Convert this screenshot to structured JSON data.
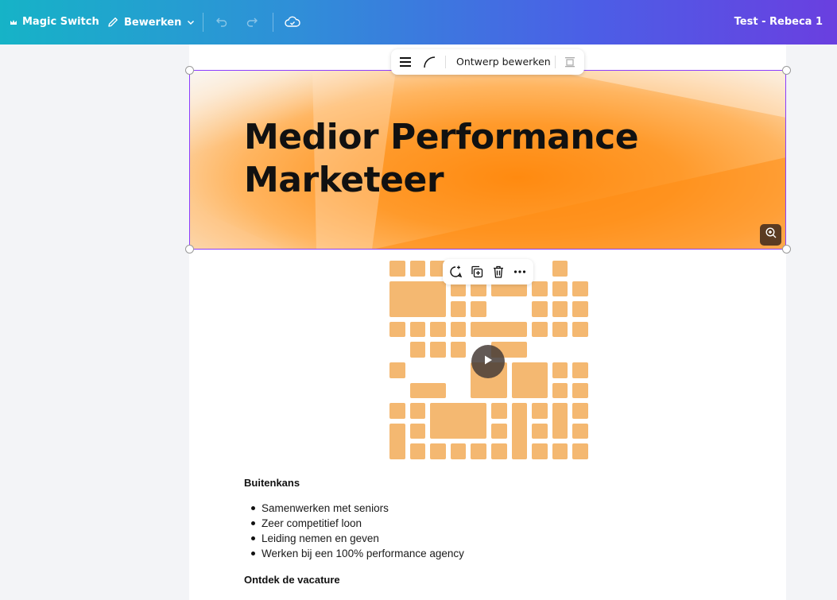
{
  "topbar": {
    "magic_switch": "Magic Switch",
    "edit_menu": "Bewerken",
    "project_title": "Test - Rebeca 1"
  },
  "floating_toolbar": {
    "edit_design": "Ontwerp bewerken"
  },
  "banner": {
    "title_line1": "Medior Performance",
    "title_line2": "Marketeer"
  },
  "content": {
    "section1_heading": "Buitenkans",
    "bullets": [
      "Samenwerken met seniors",
      "Zeer competitief loon",
      "Leiding nemen en geven",
      "Werken bij een 100% performance agency"
    ],
    "section2_heading": "Ontdek de vacature"
  },
  "colors": {
    "accent": "#8b3dff",
    "orange": "#ff8a10",
    "grid_cell": "#f4b871",
    "topbar_start": "#16b3c7",
    "topbar_end": "#6a3fe0"
  },
  "icons": {
    "magic_switch": "crown-icon",
    "edit": "pencil-icon",
    "undo": "undo-icon",
    "redo": "redo-icon",
    "cloud": "cloud-check-icon"
  }
}
